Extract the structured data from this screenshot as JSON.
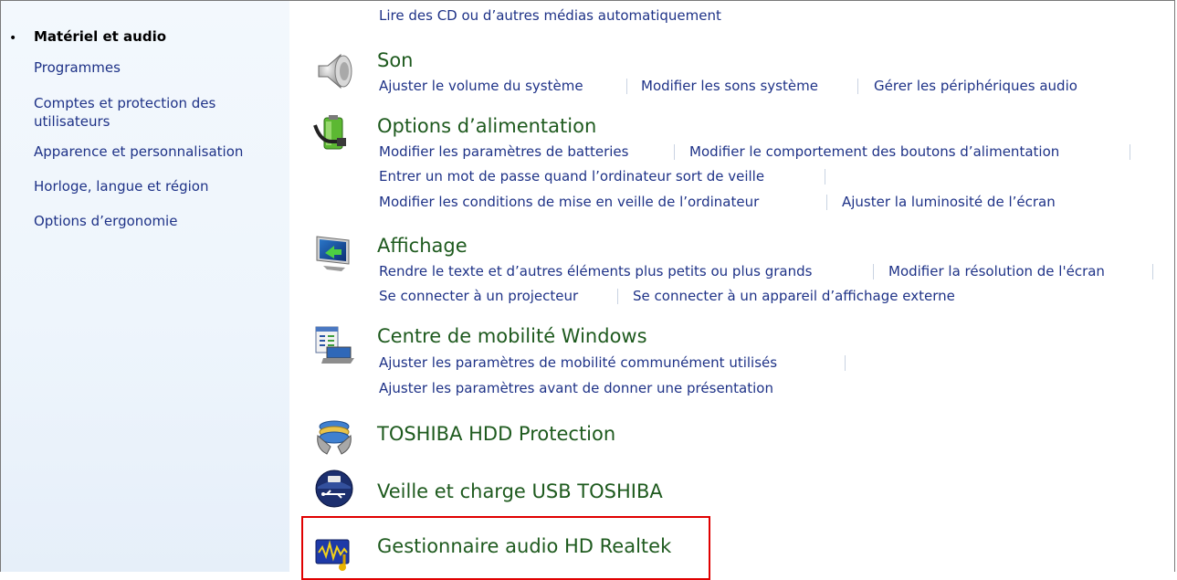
{
  "sidebar": {
    "items": [
      {
        "label": "Matériel et audio",
        "active": true
      },
      {
        "label": "Programmes"
      },
      {
        "label_line1": "Comptes et protection des",
        "label_line2": "utilisateurs"
      },
      {
        "label": "Apparence et personnalisation"
      },
      {
        "label": "Horloge, langue et région"
      },
      {
        "label": "Options d’ergonomie"
      }
    ]
  },
  "content": {
    "top_link": "Lire des CD ou d’autres médias automatiquement",
    "sections": [
      {
        "title": "Son",
        "icon": "speaker-icon",
        "links": [
          "Ajuster le volume du système",
          "Modifier les sons système",
          "Gérer les périphériques audio"
        ]
      },
      {
        "title": "Options d’alimentation",
        "icon": "battery-icon",
        "links": [
          "Modifier les paramètres de batteries",
          "Modifier le comportement des boutons d’alimentation",
          "Entrer un mot de passe quand l’ordinateur sort de veille",
          "Modifier les conditions de mise en veille de l’ordinateur",
          "Ajuster la luminosité de l’écran"
        ]
      },
      {
        "title": "Affichage",
        "icon": "monitor-icon",
        "links": [
          "Rendre le texte et d’autres éléments plus petits ou plus grands",
          "Modifier la résolution de l'écran",
          "Se connecter à un projecteur",
          "Se connecter à un appareil d’affichage externe"
        ]
      },
      {
        "title": "Centre de mobilité Windows",
        "icon": "mobility-center-icon",
        "links": [
          "Ajuster les paramètres de mobilité communément utilisés",
          "Ajuster les paramètres avant de donner une présentation"
        ]
      },
      {
        "title": "TOSHIBA HDD Protection",
        "icon": "hdd-protection-icon"
      },
      {
        "title": "Veille et charge USB TOSHIBA",
        "icon": "usb-sleep-charge-icon"
      },
      {
        "title": "Gestionnaire audio HD Realtek",
        "icon": "realtek-audio-icon",
        "highlighted": true
      }
    ]
  },
  "colors": {
    "link": "#1e3287",
    "title": "#1e5a1e",
    "highlight": "#e00000",
    "sidebar_bg": "#eef5fc"
  }
}
